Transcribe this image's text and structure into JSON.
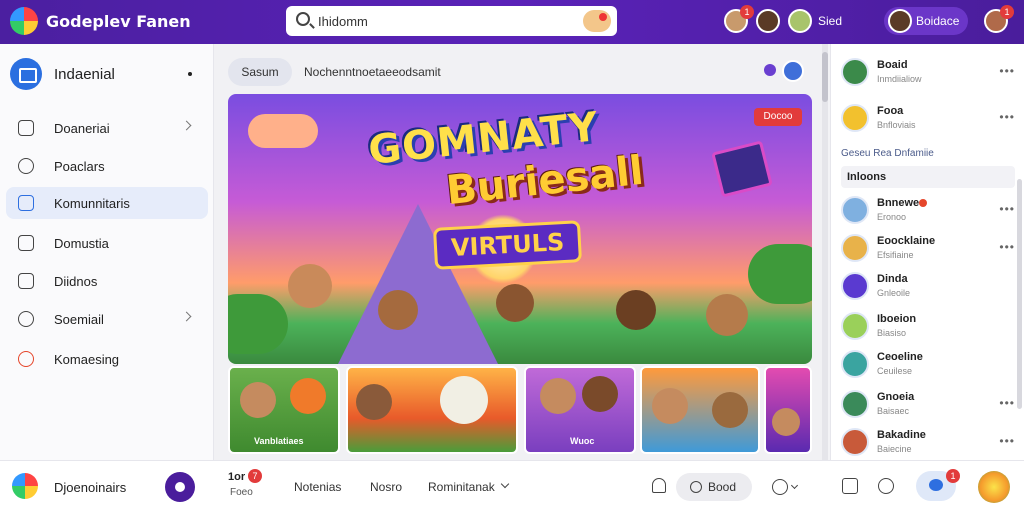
{
  "app": {
    "brand": "Godeplev Fanen"
  },
  "search": {
    "placeholder": "",
    "value": "Ihidomm",
    "notif_count": "1"
  },
  "topbar": {
    "avatar_badge_1": "1",
    "user_label": "Sied",
    "user_pill_label": "Boidace",
    "right_badge": "1"
  },
  "sidebar": {
    "header": "Indaenial",
    "items": [
      {
        "label": "Doaneriai",
        "icon": "home-icon",
        "chevron": true
      },
      {
        "label": "Poaclars",
        "icon": "heart-icon",
        "chevron": false
      },
      {
        "label": "Komunnitaris",
        "icon": "calendar-icon",
        "chevron": false,
        "active": true
      },
      {
        "label": "Domustia",
        "icon": "bookmark-icon",
        "chevron": false
      },
      {
        "label": "Diidnos",
        "icon": "message-icon",
        "chevron": false
      },
      {
        "label": "Soemiail",
        "icon": "people-icon",
        "chevron": true
      },
      {
        "label": "Komaesing",
        "icon": "chrome-icon",
        "chevron": false
      }
    ]
  },
  "main": {
    "filter_label": "Sasum",
    "filter_text": "Nochenntnoetaeeodsamit",
    "banner": {
      "line1": "GOMNATY",
      "line2": "Buriesall",
      "line3": "VIRTULS",
      "live": "Docoo"
    },
    "thumbs": [
      {
        "caption": "Vanblatiaes"
      },
      {
        "caption": ""
      },
      {
        "caption": "Wuoc"
      },
      {
        "caption": ""
      },
      {
        "caption": ""
      }
    ]
  },
  "right": {
    "top_items": [
      {
        "name": "Boaid",
        "sub": "Inmdiialiow"
      },
      {
        "name": "Fooa",
        "sub": "Bnfloviais"
      }
    ],
    "section_label": "Geseu Rea  Dnfamiie",
    "section_tag": "Inloons",
    "people": [
      {
        "name": "Bnnewe",
        "sub": "Eronoo",
        "dot": true
      },
      {
        "name": "Eoocklaine",
        "sub": "Efsifiaine"
      },
      {
        "name": "Dinda",
        "sub": "Gnleoile"
      },
      {
        "name": "Iboeion",
        "sub": "Biasiso"
      },
      {
        "name": "Ceoeline",
        "sub": "Ceuilese"
      },
      {
        "name": "Gnoeia",
        "sub": "Baisaec"
      },
      {
        "name": "Bakadine",
        "sub": "Baiecine"
      }
    ]
  },
  "bottombar": {
    "profile_name": "Djoenoinairs",
    "count": "1or",
    "count_badge": "7",
    "sub": "Foeo",
    "tabs": [
      "Notenias",
      "Nosro",
      "Rominitanak"
    ],
    "pill_label": "Bood",
    "chat_badge": "1"
  }
}
